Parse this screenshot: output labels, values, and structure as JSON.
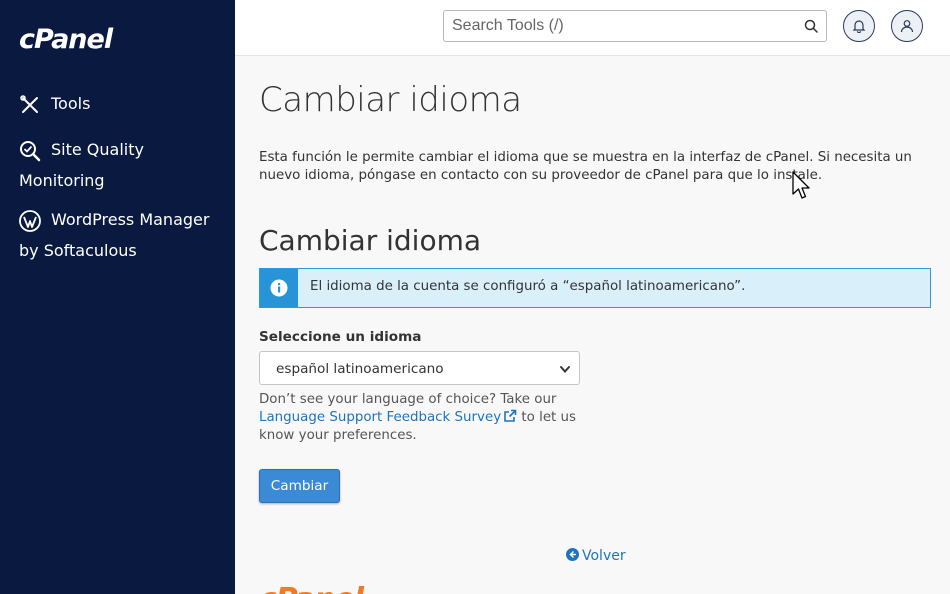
{
  "sidebar": {
    "logo": "cPanel",
    "items": [
      {
        "label": "Tools",
        "icon": "tools-icon"
      },
      {
        "label": "Site Quality Monitoring",
        "icon": "magnifier-check-icon"
      },
      {
        "label": "WordPress Manager by Softaculous",
        "icon": "wordpress-icon"
      }
    ]
  },
  "topbar": {
    "search_placeholder": "Search Tools (/)",
    "icons": [
      "search-icon",
      "bell-icon",
      "user-icon"
    ]
  },
  "main": {
    "title": "Cambiar idioma",
    "description": "Esta función le permite cambiar el idioma que se muestra en la interfaz de cPanel. Si necesita un nuevo idioma, póngase en contacto con su proveedor de cPanel para que lo instale.",
    "section_title": "Cambiar idioma",
    "alert_text": "El idioma de la cuenta se configuró a “español latinoamericano”.",
    "select_label": "Seleccione un idioma",
    "select_value": "español latinoamericano",
    "help_before": "Don’t see your language of choice? Take our ",
    "help_link": "Language Support Feedback Survey",
    "help_after": " to let us know your preferences.",
    "submit_label": "Cambiar",
    "back_label": "Volver",
    "footer_logo": "cPanel"
  },
  "colors": {
    "sidebar_bg": "#09193f",
    "primary_button": "#3a8ad6",
    "alert_bg": "#d9f0fb",
    "alert_accent": "#2694d6",
    "link": "#1e73be",
    "footer_logo": "#f07a25"
  }
}
